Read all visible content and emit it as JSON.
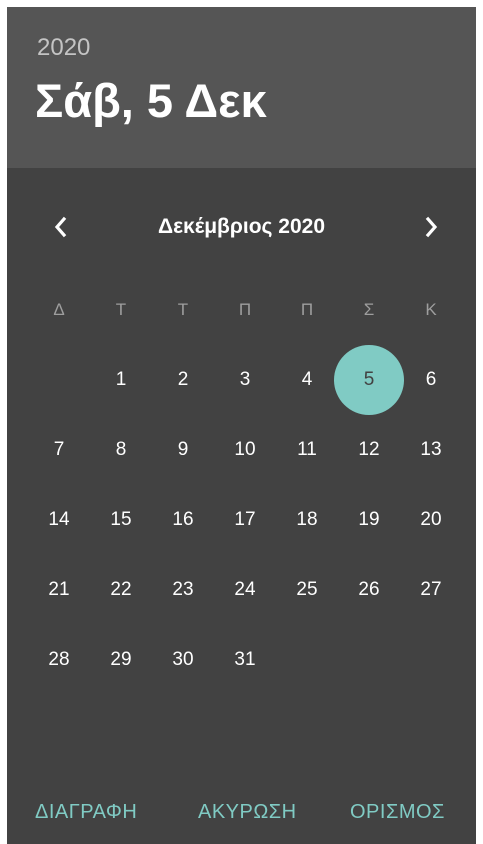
{
  "header": {
    "year": "2020",
    "selected_date": "Σάβ, 5 Δεκ"
  },
  "calendar": {
    "month_title": "Δεκέμβριος 2020",
    "prev_icon": "chevron-left-icon",
    "next_icon": "chevron-right-icon",
    "weekdays": [
      "Δ",
      "Τ",
      "Τ",
      "Π",
      "Π",
      "Σ",
      "Κ"
    ],
    "leading_blank_days": 1,
    "days": [
      "1",
      "2",
      "3",
      "4",
      "5",
      "6",
      "7",
      "8",
      "9",
      "10",
      "11",
      "12",
      "13",
      "14",
      "15",
      "16",
      "17",
      "18",
      "19",
      "20",
      "21",
      "22",
      "23",
      "24",
      "25",
      "26",
      "27",
      "28",
      "29",
      "30",
      "31"
    ],
    "selected_day": "5"
  },
  "actions": {
    "clear_label": "ΔΙΑΓΡΑΦΗ",
    "cancel_label": "ΑΚΥΡΩΣΗ",
    "ok_label": "ΟΡΙΣΜΟΣ"
  },
  "colors": {
    "dialog_background": "#424242",
    "header_background": "#555555",
    "accent": "#80cbc4",
    "text_primary": "#ffffff",
    "text_secondary": "#9e9e9e"
  }
}
